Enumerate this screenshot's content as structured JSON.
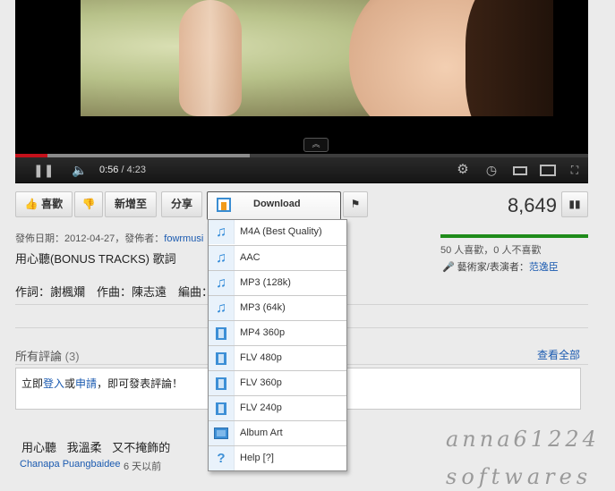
{
  "player": {
    "current_time": "0:56",
    "separator": " / ",
    "duration": "4:23",
    "progress_fraction": 0.056,
    "buffer_fraction": 0.41
  },
  "actions": {
    "like_label": "喜歡",
    "add_to_label": "新增至",
    "share_label": "分享",
    "download_label": "Download"
  },
  "views": "8,649",
  "info": {
    "publish_prefix": "發佈日期：2012-04-27，發佈者：",
    "publisher": "fowrmusi",
    "title": "用心聽(BONUS TRACKS) 歌詞",
    "credits": "作詞：謝楓斕　作曲：陳志遠　編曲："
  },
  "rating": {
    "likes_text": "50 人喜歡，0 人不喜歡",
    "artist_label": "藝術家/表演者：",
    "artist_name": "范逸臣",
    "accent": "#1f8c1a"
  },
  "comments": {
    "title": "所有評論",
    "count": "(3)",
    "view_all": "查看全部",
    "prompt_prefix": "立即",
    "login": "登入",
    "or": "或",
    "signup": "申請",
    "prompt_suffix": "，即可發表評論！",
    "items": [
      {
        "text": "用心聽 我溫柔 又不掩飾的",
        "author": "Chanapa Puangbaidee",
        "time": "6 天以前"
      }
    ]
  },
  "download_menu": [
    {
      "label": "M4A (Best Quality)",
      "icon": "music-note-icon"
    },
    {
      "label": "AAC",
      "icon": "music-note-icon"
    },
    {
      "label": "MP3 (128k)",
      "icon": "music-note-icon"
    },
    {
      "label": "MP3 (64k)",
      "icon": "music-note-icon"
    },
    {
      "label": "MP4 360p",
      "icon": "film-icon"
    },
    {
      "label": "FLV 480p",
      "icon": "film-icon"
    },
    {
      "label": "FLV 360p",
      "icon": "film-icon"
    },
    {
      "label": "FLV 240p",
      "icon": "film-icon"
    },
    {
      "label": "Album Art",
      "icon": "picture-icon"
    },
    {
      "label": "Help [?]",
      "icon": "help-icon"
    }
  ],
  "watermark": {
    "line1": "anna61224",
    "line2": "softwares"
  }
}
